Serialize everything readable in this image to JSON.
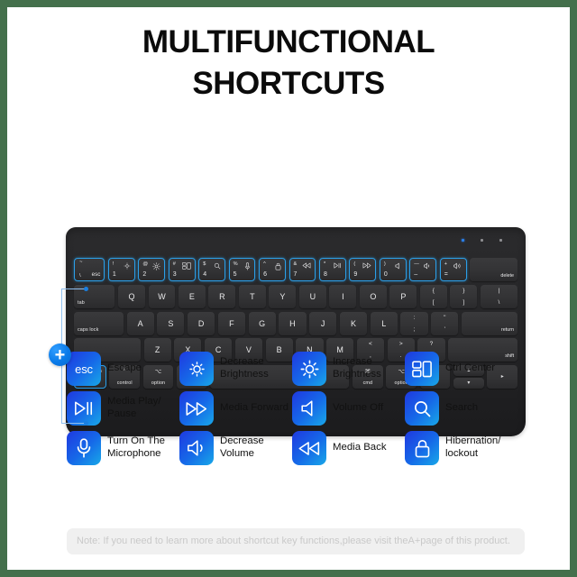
{
  "theme": {
    "border_color": "#44704c",
    "page_bg": "#ffffff",
    "accent_blue": "#1668e8",
    "badge_gradient_start": "#1f39e0",
    "badge_gradient_end": "#18a8e8",
    "key_highlight": "#2b9fe8"
  },
  "title": {
    "line1": "MULTIFUNCTIONAL",
    "line2": "SHORTCUTS"
  },
  "keyboard": {
    "plus_badge": "+",
    "row_function": [
      {
        "main": "esc",
        "sub_top": "~",
        "sub_bottom": "\\",
        "icon": "",
        "highlight": true
      },
      {
        "main": "1",
        "sub_top": "!",
        "icon": "brightness-down-icon",
        "highlight": true
      },
      {
        "main": "2",
        "sub_top": "@",
        "icon": "brightness-up-icon",
        "highlight": true
      },
      {
        "main": "3",
        "sub_top": "#",
        "icon": "control-center-icon",
        "highlight": true
      },
      {
        "main": "4",
        "sub_top": "$",
        "icon": "search-icon",
        "highlight": true
      },
      {
        "main": "5",
        "sub_top": "%",
        "icon": "microphone-icon",
        "highlight": true
      },
      {
        "main": "6",
        "sub_top": "^",
        "icon": "lock-icon",
        "highlight": true
      },
      {
        "main": "7",
        "sub_top": "&",
        "icon": "media-back-icon",
        "highlight": true
      },
      {
        "main": "8",
        "sub_top": "*",
        "icon": "media-play-pause-icon",
        "highlight": true
      },
      {
        "main": "9",
        "sub_top": "(",
        "icon": "media-forward-icon",
        "highlight": true
      },
      {
        "main": "0",
        "sub_top": ")",
        "icon": "volume-off-icon",
        "highlight": true
      },
      {
        "main": "–",
        "sub_top": "—",
        "icon": "volume-down-icon",
        "highlight": true
      },
      {
        "main": "=",
        "sub_top": "+",
        "icon": "volume-up-icon",
        "highlight": true
      },
      {
        "main": "delete",
        "label_style": "bottom-right",
        "highlight": false
      }
    ],
    "row_qwerty": [
      "tab",
      "Q",
      "W",
      "E",
      "R",
      "T",
      "Y",
      "U",
      "I",
      "O",
      "P",
      "{",
      "}",
      "|"
    ],
    "row_qwerty_sub": [
      "",
      "",
      "",
      "",
      "",
      "",
      "",
      "",
      "",
      "",
      "",
      "[",
      "]",
      "\\"
    ],
    "row_home": [
      "caps lock",
      "A",
      "S",
      "D",
      "F",
      "G",
      "H",
      "J",
      "K",
      "L",
      ":",
      "\"",
      "return"
    ],
    "row_home_sub": [
      "",
      "",
      "",
      "",
      "",
      "",
      "",
      "",
      "",
      "",
      ";",
      "'",
      ""
    ],
    "row_shift": [
      "shift",
      "Z",
      "X",
      "C",
      "V",
      "B",
      "N",
      "M",
      "<",
      ">",
      "?",
      "shift"
    ],
    "row_shift_sub": [
      "",
      "",
      "",
      "",
      "",
      "",
      "",
      "",
      ",",
      ".",
      "/",
      ""
    ],
    "row_bottom": [
      "fn",
      "control",
      "option",
      "cmd",
      "",
      "cmd",
      "option"
    ],
    "row_bottom_symbols": [
      "",
      "^",
      "⌥",
      "⌘",
      "",
      "⌘",
      "⌥"
    ],
    "arrows": {
      "left": "◂",
      "up": "▴",
      "down": "▾",
      "right": "▸"
    }
  },
  "legend": {
    "rows": [
      [
        {
          "icon": "esc-icon",
          "icon_text": "esc",
          "label": "Escape"
        },
        {
          "icon": "brightness-down-icon",
          "label": "Decrease Brightness"
        },
        {
          "icon": "brightness-up-icon",
          "label": "Increase Brightness"
        },
        {
          "icon": "control-center-icon",
          "label": "Ctrl Center"
        }
      ],
      [
        {
          "icon": "media-play-pause-icon",
          "label": "Media Play/ Pause"
        },
        {
          "icon": "media-forward-icon",
          "label": "Media Forward"
        },
        {
          "icon": "volume-off-icon",
          "label": "Volume Off"
        },
        {
          "icon": "search-icon",
          "label": "Search"
        }
      ],
      [
        {
          "icon": "microphone-icon",
          "label": "Turn On The Microphone"
        },
        {
          "icon": "volume-down-icon",
          "label": "Decrease Volume"
        },
        {
          "icon": "media-back-icon",
          "label": "Media Back"
        },
        {
          "icon": "lock-icon",
          "label": "Hibernation/ lockout"
        }
      ]
    ]
  },
  "note": {
    "text": "Note: If you need to learn more about shortcut key functions,please visit theA+page of this product."
  }
}
